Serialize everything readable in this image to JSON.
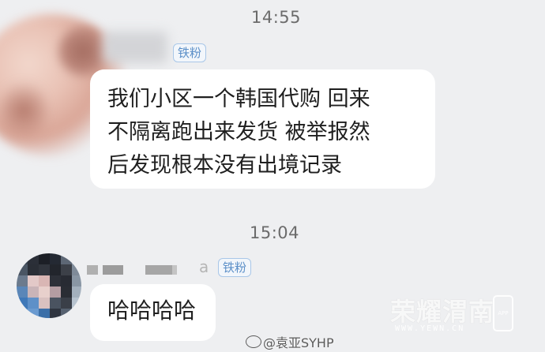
{
  "chat": {
    "time_1": "14:55",
    "time_2": "15:04",
    "messages": [
      {
        "badge": "铁粉",
        "lines": [
          "我们小区一个韩国代购 回来",
          "不隔离跑出来发货 被举报然",
          "后发现根本没有出境记录"
        ]
      },
      {
        "badge": "铁粉",
        "name_tail": "a",
        "text": "哈哈哈哈"
      }
    ]
  },
  "watermarks": {
    "logo": "荣耀渭南",
    "url": "WWW.YEWN.CN",
    "app_label": "APP",
    "weibo": "@袁亚SYHP"
  },
  "icons": {
    "weibo": "weibo-logo-icon",
    "app": "phone-app-icon"
  }
}
